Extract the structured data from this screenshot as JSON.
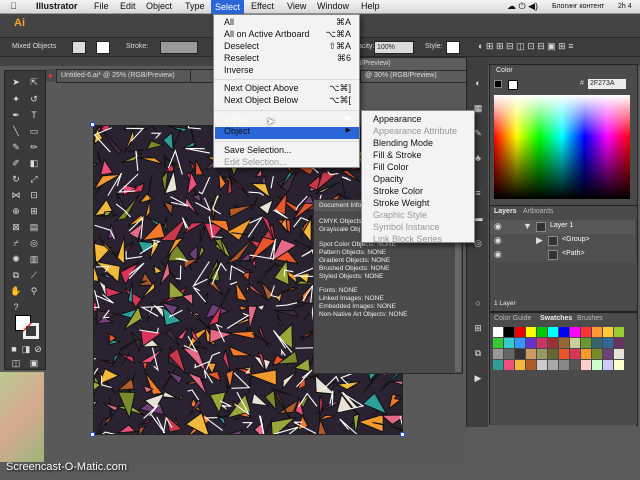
{
  "menubar": {
    "app": "Illustrator",
    "items": [
      "File",
      "Edit",
      "Object",
      "Type",
      "Select",
      "Effect",
      "View",
      "Window",
      "Help"
    ],
    "status_text": "Блогинг контент",
    "clock": "2h 4"
  },
  "control": {
    "selection_label": "Mixed Objects",
    "stroke_label": "Stroke:",
    "opacity_label": "acity:",
    "opacity_value": "100%",
    "style_label": "Style:"
  },
  "app_logo": "Ai",
  "documents": [
    {
      "title": "Untitled-6.ai* @ 25% (RGB/Preview)"
    },
    {
      "title": "30% (RGB/Preview)"
    },
    {
      "title": "@ 30% (RGB/Preview)"
    }
  ],
  "select_menu": {
    "items": [
      {
        "label": "All",
        "shortcut": "⌘A"
      },
      {
        "label": "All on Active Artboard",
        "shortcut": "⌥⌘A"
      },
      {
        "label": "Deselect",
        "shortcut": "⇧⌘A"
      },
      {
        "label": "Reselect",
        "shortcut": "⌘6"
      },
      {
        "label": "Inverse",
        "shortcut": ""
      },
      {
        "label": "Next Object Above",
        "shortcut": "⌥⌘]"
      },
      {
        "label": "Next Object Below",
        "shortcut": "⌥⌘["
      },
      {
        "label": "Same",
        "shortcut": "▶"
      },
      {
        "label": "Object",
        "shortcut": "▶"
      },
      {
        "label": "Save Selection...",
        "shortcut": ""
      },
      {
        "label": "Edit Selection...",
        "shortcut": ""
      }
    ]
  },
  "same_submenu": [
    "Appearance",
    "Appearance Attribute",
    "Blending Mode",
    "Fill & Stroke",
    "Fill Color",
    "Opacity",
    "Stroke Color",
    "Stroke Weight",
    "Graphic Style",
    "Symbol Instance",
    "Link Block Series"
  ],
  "doc_info": {
    "title": "Document Info",
    "lines": [
      "CMYK Objects",
      "Grayscale Obj",
      "Spot Color Objects: NONE",
      "Pattern Objects: NONE",
      "Gradient Objects: NONE",
      "Brushed Objects: NONE",
      "Styled Objects: NONE",
      "Fonts: NONE",
      "Linked Images: NONE",
      "Embedded Images: NONE",
      "Non-Native Art Objects: NONE"
    ]
  },
  "color_panel": {
    "title": "Color",
    "hex": "2F273A",
    "hex_prefix": "#"
  },
  "layers_panel": {
    "tabs": [
      "Layers",
      "Artboards"
    ],
    "rows": [
      "Layer 1",
      "<Group>",
      "<Path>"
    ],
    "footer": "1 Layer"
  },
  "swatches_panel": {
    "tabs": [
      "Color Guide",
      "Swatches",
      "Brushes"
    ]
  },
  "watermark": "Screencast-O-Matic.com",
  "accent": "#2a66d8"
}
